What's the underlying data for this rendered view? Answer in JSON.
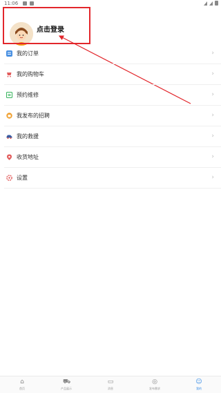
{
  "status_bar": {
    "time": "11:06"
  },
  "header": {
    "login_text": "点击登录"
  },
  "menu": [
    {
      "label": "我的订单",
      "icon": "order-icon",
      "color": "#4a90e2"
    },
    {
      "label": "我的购物车",
      "icon": "cart-icon",
      "color": "#e25b5b"
    },
    {
      "label": "预约维修",
      "icon": "repair-icon",
      "color": "#34b35a"
    },
    {
      "label": "我发布的招聘",
      "icon": "recruit-icon",
      "color": "#f0a030"
    },
    {
      "label": "我的救援",
      "icon": "rescue-icon",
      "color": "#d9403a"
    },
    {
      "label": "收货地址",
      "icon": "address-icon",
      "color": "#e25b5b"
    },
    {
      "label": "设置",
      "icon": "settings-icon",
      "color": "#e25b5b"
    }
  ],
  "tabs": [
    {
      "label": "首页",
      "icon": "home-icon"
    },
    {
      "label": "产品展示",
      "icon": "car-icon"
    },
    {
      "label": "消息",
      "icon": "message-icon"
    },
    {
      "label": "发布需求",
      "icon": "publish-icon"
    },
    {
      "label": "我的",
      "icon": "user-icon"
    }
  ],
  "colors": {
    "annotation": "#e2262b",
    "active_tab": "#3a8ee6"
  }
}
